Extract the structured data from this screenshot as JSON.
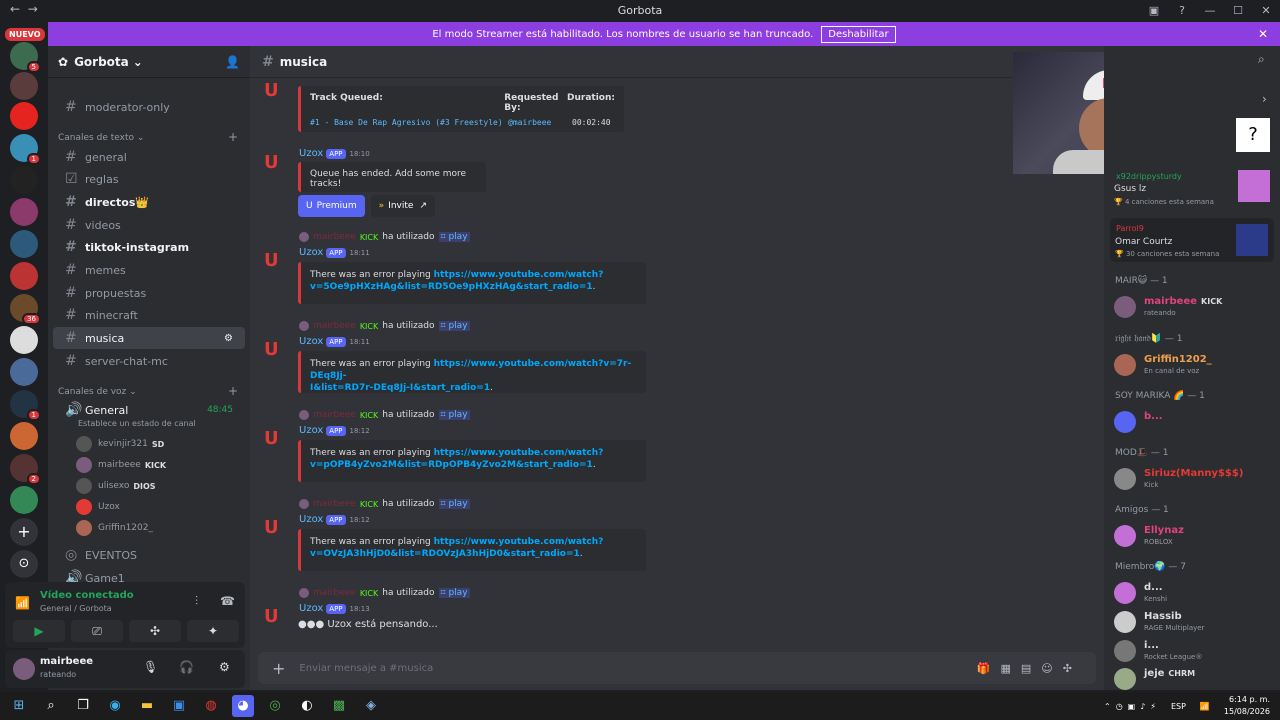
{
  "window": {
    "title": "Gorbota",
    "back": "←",
    "forward": "→"
  },
  "streamer": {
    "text": "El modo Streamer está habilitado. Los nombres de usuario se han truncado.",
    "button": "Deshabilitar"
  },
  "guilds": {
    "nuevo": "NUEVO",
    "badges": [
      "5",
      "1",
      "36",
      "1",
      "2"
    ]
  },
  "server": {
    "name": "Gorbota"
  },
  "channels": {
    "top": "moderator-only",
    "text_category": "Canales de texto",
    "items": [
      "general",
      "reglas",
      "directos👑",
      "videos",
      "tiktok-instagram",
      "memes",
      "propuestas",
      "minecraft",
      "musica",
      "server-chat-mc"
    ],
    "voice_category": "Canales de voz",
    "voice_channel": "General",
    "voice_timer": "48:45",
    "voice_status": "Establece un estado de canal",
    "voice_users": [
      {
        "name": "kevinjir321",
        "tag": "SD"
      },
      {
        "name": "mairbeee",
        "tag": "KICK"
      },
      {
        "name": "ulisexo",
        "tag": "DIOS"
      },
      {
        "name": "Uzox",
        "tag": ""
      },
      {
        "name": "Griffin1202_",
        "tag": ""
      }
    ],
    "events": "EVENTOS",
    "game": "Game1"
  },
  "vc": {
    "title": "Vídeo conectado",
    "sub": "General / Gorbota"
  },
  "user": {
    "name": "mairbeee",
    "status": "rateando"
  },
  "chat": {
    "channel": "musica",
    "bot_name": "Uzox",
    "app": "APP",
    "queued": {
      "h1": "Track Queued:",
      "h2": "Requested By:",
      "h3": "Duration:",
      "track": "#1 - Base De Rap Agresivo (#3 Freestyle)",
      "by": "@mairbeee",
      "dur": "00:02:40"
    },
    "ended_time": "18:10",
    "ended": "Queue has ended. Add some more tracks!",
    "premium": "Premium",
    "invite": "Invite",
    "used": "ha utilizado",
    "cmd": "⌗ play",
    "replier": "mairbeee",
    "kick": "KICK",
    "errors": [
      {
        "time": "18:11",
        "text": "There was an error playing ",
        "url": "https://www.youtube.com/watch?v=5Oe9pHXzHAg&list=RD5Oe9pHXzHAg&start_radio=1",
        "url1": "https://www.youtube.com/watch?",
        "url2": "v=5Oe9pHXzHAg&list=RD5Oe9pHXzHAg&start_radio=1"
      },
      {
        "time": "18:11",
        "text": "There was an error playing ",
        "url1": "https://www.youtube.com/watch?v=7r-DEq8Jj-",
        "url2": "I&list=RD7r-DEq8Jj-I&start_radio=1"
      },
      {
        "time": "18:12",
        "text": "There was an error playing ",
        "url1": "https://www.youtube.com/watch?",
        "url2": "v=pOPB4yZvo2M&list=RDpOPB4yZvo2M&start_radio=1"
      },
      {
        "time": "18:12",
        "text": "There was an error playing ",
        "url1": "https://www.youtube.com/watch?",
        "url2": "v=OVzJA3hHjD0&list=RDOVzJA3hHjD0&start_radio=1"
      }
    ],
    "last_time": "18:13",
    "thinking": "Uzox está pensando...",
    "placeholder": "Enviar mensaje a #musica"
  },
  "members": {
    "cards": [
      {
        "name": "x92drippysturdy",
        "title": "Gsus lz",
        "sub": "4 canciones esta semana"
      },
      {
        "name": "Parrol9",
        "title": "Omar Courtz",
        "sub": "30 canciones esta semana"
      }
    ],
    "groups": [
      {
        "label": "MAIR😺 — 1",
        "members": [
          {
            "name": "mairbeee",
            "status": "rateando",
            "tag": "KICK",
            "color": "#e0437d"
          }
        ]
      },
      {
        "label": "𝔯𝔦𝔤𝔥𝔱 𝔥𝔞𝔫𝔡🔰 — 1",
        "members": [
          {
            "name": "Griffin1202_",
            "status": "En canal de voz",
            "color": "#f0a04b"
          }
        ]
      },
      {
        "label": "SOY MARIKA 🌈 — 1",
        "members": [
          {
            "name": "b...",
            "status": "",
            "color": "#e0437d"
          }
        ]
      },
      {
        "label": "MOD🎩 — 1",
        "members": [
          {
            "name": "Siriuz(Manny$$$)",
            "status": "Kick",
            "color": "#e53935"
          }
        ]
      },
      {
        "label": "Amigos — 1",
        "members": [
          {
            "name": "Ellynaz",
            "status": "ROBLOX",
            "color": "#e0437d"
          }
        ]
      },
      {
        "label": "Miembro🌍 — 7",
        "members": [
          {
            "name": "d...",
            "status": "Kenshi",
            "color": "#dbdee1"
          },
          {
            "name": "Hassib",
            "status": "RAGE Multiplayer",
            "color": "#dbdee1"
          },
          {
            "name": "i...",
            "status": "Rocket League®",
            "color": "#dbdee1"
          },
          {
            "name": "jeje",
            "status": "",
            "tag": "CHRM",
            "color": "#dbdee1"
          }
        ]
      }
    ]
  },
  "taskbar": {
    "lang": "ESP",
    "time": "6:14 p. m.",
    "date": "15/08/2026"
  }
}
